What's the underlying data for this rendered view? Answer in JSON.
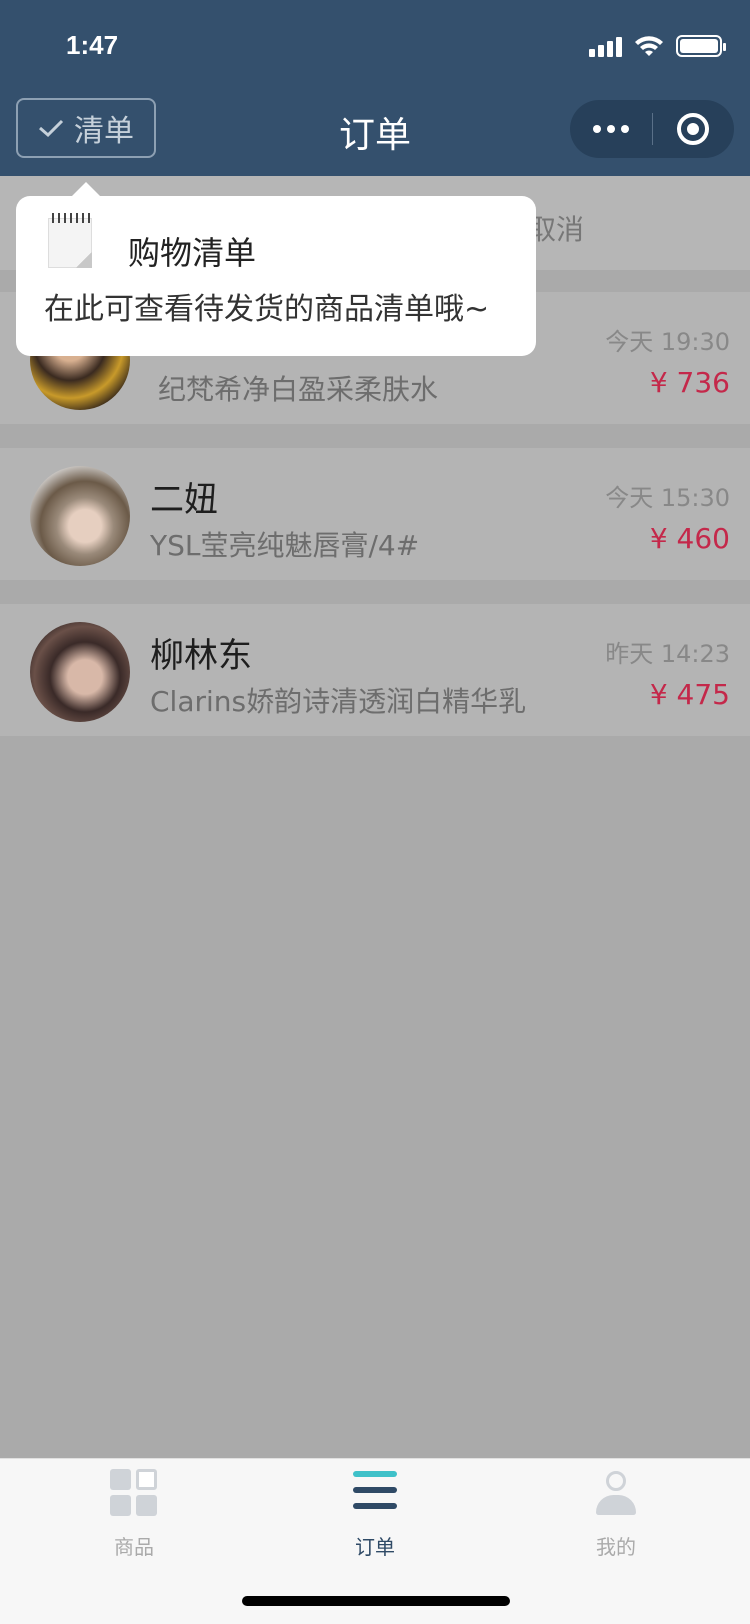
{
  "status_bar": {
    "time": "1:47"
  },
  "header": {
    "list_button_label": "清单",
    "title": "订单"
  },
  "filter_bar": {
    "visible_tab": "取消"
  },
  "tooltip": {
    "title": "购物清单",
    "body": "在此可查看待发货的商品清单哦~"
  },
  "orders": [
    {
      "name": "",
      "item": "纪梵希净白盈采柔肤水",
      "time": "今天 19:30",
      "price": "¥ 736"
    },
    {
      "name": "二妞",
      "item": "YSL莹亮纯魅唇膏/4#",
      "time": "今天 15:30",
      "price": "¥ 460"
    },
    {
      "name": "柳林东",
      "item": "Clarins娇韵诗清透润白精华乳",
      "time": "昨天 14:23",
      "price": "¥ 475"
    }
  ],
  "tabbar": {
    "items": [
      {
        "label": "商品",
        "icon": "grid-icon"
      },
      {
        "label": "订单",
        "icon": "list-icon",
        "active": true
      },
      {
        "label": "我的",
        "icon": "person-icon"
      }
    ]
  },
  "colors": {
    "header": "#34506d",
    "price": "#c4284a",
    "overlay": "#aaaaaa"
  }
}
